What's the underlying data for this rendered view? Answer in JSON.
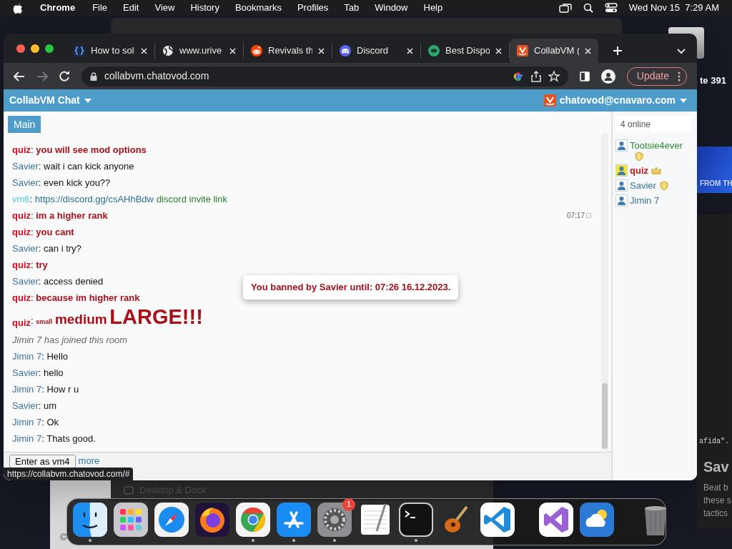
{
  "menu_bar": {
    "app": "Chrome",
    "items": [
      "File",
      "Edit",
      "View",
      "History",
      "Bookmarks",
      "Profiles",
      "Tab",
      "Window",
      "Help"
    ],
    "clock": "Wed Nov 15  7:29 AM"
  },
  "background": {
    "badge_text": "te 391",
    "banner_text": "FROM TH",
    "code_text": "afida\".",
    "heading": "Sav",
    "body_lines": [
      "Beat b",
      "these s",
      "tactics"
    ],
    "settings_item": "Desktop & Dock",
    "copyright": "©"
  },
  "browser": {
    "tabs": [
      {
        "title": "How to sol",
        "selected": false
      },
      {
        "title": "www.urive",
        "selected": false
      },
      {
        "title": "Revivals th",
        "selected": false
      },
      {
        "title": "Discord",
        "selected": false
      },
      {
        "title": "Best Dispo",
        "selected": false
      },
      {
        "title": "CollabVM (",
        "selected": true
      }
    ],
    "address": "collabvm.chatovod.com",
    "update_label": "Update",
    "status_url": "https://collabvm.chatovod.com/#"
  },
  "chat": {
    "title": "CollabVM Chat",
    "account": "chatovod@cnavaro.com",
    "rooms": [
      {
        "label": "Main",
        "selected": true
      }
    ],
    "separator": ":",
    "messages": [
      {
        "kind": "mod",
        "author": "quiz",
        "parts": [
          {
            "kind": "text",
            "text": "you will see mod options"
          }
        ]
      },
      {
        "kind": "user",
        "author": "Savier",
        "parts": [
          {
            "kind": "text",
            "text": "wait i can kick anyone"
          }
        ]
      },
      {
        "kind": "user",
        "author": "Savier",
        "parts": [
          {
            "kind": "text",
            "text": "even kick you??"
          }
        ]
      },
      {
        "kind": "guest",
        "author": "vm6",
        "parts": [
          {
            "kind": "link",
            "text": "https://discord.gg/csAHhBdw"
          },
          {
            "kind": "comment",
            "text": "discord invite link"
          }
        ]
      },
      {
        "kind": "mod",
        "author": "quiz",
        "time": "07:17",
        "parts": [
          {
            "kind": "text",
            "text": "im a higher rank"
          }
        ]
      },
      {
        "kind": "mod",
        "author": "quiz",
        "parts": [
          {
            "kind": "text",
            "text": "you cant"
          }
        ]
      },
      {
        "kind": "user",
        "author": "Savier",
        "parts": [
          {
            "kind": "text",
            "text": "can i try?"
          }
        ]
      },
      {
        "kind": "mod",
        "author": "quiz",
        "parts": [
          {
            "kind": "text",
            "text": "try"
          }
        ]
      },
      {
        "kind": "user",
        "author": "Savier",
        "parts": [
          {
            "kind": "text",
            "text": "access denied"
          }
        ]
      },
      {
        "kind": "mod",
        "author": "quiz",
        "parts": [
          {
            "kind": "text",
            "text": "because im higher rank"
          }
        ]
      },
      {
        "kind": "mod",
        "author": "quiz",
        "parts": [
          {
            "kind": "small",
            "text": "small"
          },
          {
            "kind": "medium",
            "text": "medium"
          },
          {
            "kind": "large",
            "text": "LARGE!!!"
          }
        ]
      },
      {
        "kind": "system",
        "text": "Jimin 7 has joined this room"
      },
      {
        "kind": "user",
        "author": "Jimin 7",
        "parts": [
          {
            "kind": "text",
            "text": "Hello"
          }
        ]
      },
      {
        "kind": "user",
        "author": "Savier",
        "parts": [
          {
            "kind": "text",
            "text": "hello"
          }
        ]
      },
      {
        "kind": "user",
        "author": "Jimin 7",
        "parts": [
          {
            "kind": "text",
            "text": "How r u"
          }
        ]
      },
      {
        "kind": "user",
        "author": "Savier",
        "parts": [
          {
            "kind": "text",
            "text": "um"
          }
        ]
      },
      {
        "kind": "user",
        "author": "Jimin 7",
        "parts": [
          {
            "kind": "text",
            "text": "Ok"
          }
        ]
      },
      {
        "kind": "user",
        "author": "Jimin 7",
        "parts": [
          {
            "kind": "text",
            "text": "Thats good."
          }
        ]
      }
    ],
    "online_count": "4 online",
    "users": [
      {
        "kind": "moderator",
        "name": "Tootsie4ever",
        "color": "#2e8b2e",
        "highlighted": false
      },
      {
        "kind": "owner",
        "name": "quiz",
        "color": "#d0101a",
        "highlighted": true
      },
      {
        "kind": "moderator",
        "name": "Savier",
        "color": "#3d7399",
        "highlighted": false
      },
      {
        "kind": "member",
        "name": "Jimin 7",
        "color": "#3d7399",
        "highlighted": false
      }
    ],
    "notice": "You banned by Savier until: 07:26 16.12.2023.",
    "enter_button": "Enter as vm4",
    "more_link": "more"
  },
  "dock": [
    {
      "kind": "finder",
      "running": true
    },
    {
      "kind": "launchpad",
      "running": false
    },
    {
      "kind": "safari",
      "running": false
    },
    {
      "kind": "firefox",
      "running": false
    },
    {
      "kind": "chrome",
      "running": true
    },
    {
      "kind": "appstore",
      "running": true
    },
    {
      "kind": "settings",
      "running": true,
      "badge": "1"
    },
    {
      "kind": "textedit",
      "running": false
    },
    {
      "kind": "terminal",
      "running": true
    },
    {
      "kind": "guitar",
      "running": false
    },
    {
      "kind": "vscode",
      "running": false
    },
    {
      "kind": "separator"
    },
    {
      "kind": "visualstudio",
      "running": false
    },
    {
      "kind": "weather",
      "running": false
    },
    {
      "kind": "separator"
    },
    {
      "kind": "trash",
      "running": false
    }
  ]
}
